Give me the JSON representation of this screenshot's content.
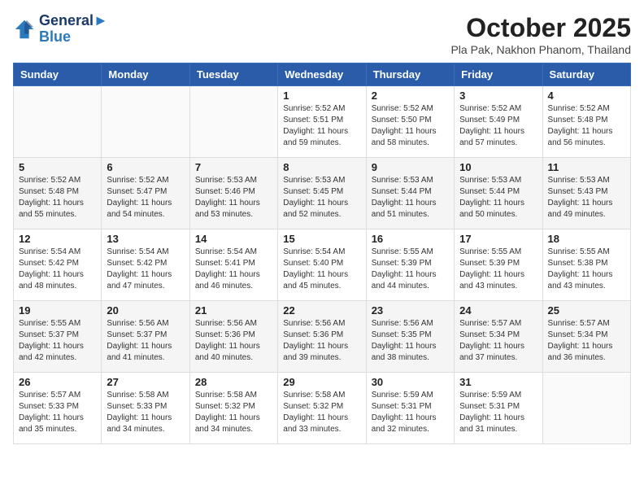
{
  "header": {
    "logo_line1": "General",
    "logo_line2": "Blue",
    "month": "October 2025",
    "location": "Pla Pak, Nakhon Phanom, Thailand"
  },
  "weekdays": [
    "Sunday",
    "Monday",
    "Tuesday",
    "Wednesday",
    "Thursday",
    "Friday",
    "Saturday"
  ],
  "weeks": [
    [
      {
        "day": "",
        "info": ""
      },
      {
        "day": "",
        "info": ""
      },
      {
        "day": "",
        "info": ""
      },
      {
        "day": "1",
        "info": "Sunrise: 5:52 AM\nSunset: 5:51 PM\nDaylight: 11 hours\nand 59 minutes."
      },
      {
        "day": "2",
        "info": "Sunrise: 5:52 AM\nSunset: 5:50 PM\nDaylight: 11 hours\nand 58 minutes."
      },
      {
        "day": "3",
        "info": "Sunrise: 5:52 AM\nSunset: 5:49 PM\nDaylight: 11 hours\nand 57 minutes."
      },
      {
        "day": "4",
        "info": "Sunrise: 5:52 AM\nSunset: 5:48 PM\nDaylight: 11 hours\nand 56 minutes."
      }
    ],
    [
      {
        "day": "5",
        "info": "Sunrise: 5:52 AM\nSunset: 5:48 PM\nDaylight: 11 hours\nand 55 minutes."
      },
      {
        "day": "6",
        "info": "Sunrise: 5:52 AM\nSunset: 5:47 PM\nDaylight: 11 hours\nand 54 minutes."
      },
      {
        "day": "7",
        "info": "Sunrise: 5:53 AM\nSunset: 5:46 PM\nDaylight: 11 hours\nand 53 minutes."
      },
      {
        "day": "8",
        "info": "Sunrise: 5:53 AM\nSunset: 5:45 PM\nDaylight: 11 hours\nand 52 minutes."
      },
      {
        "day": "9",
        "info": "Sunrise: 5:53 AM\nSunset: 5:44 PM\nDaylight: 11 hours\nand 51 minutes."
      },
      {
        "day": "10",
        "info": "Sunrise: 5:53 AM\nSunset: 5:44 PM\nDaylight: 11 hours\nand 50 minutes."
      },
      {
        "day": "11",
        "info": "Sunrise: 5:53 AM\nSunset: 5:43 PM\nDaylight: 11 hours\nand 49 minutes."
      }
    ],
    [
      {
        "day": "12",
        "info": "Sunrise: 5:54 AM\nSunset: 5:42 PM\nDaylight: 11 hours\nand 48 minutes."
      },
      {
        "day": "13",
        "info": "Sunrise: 5:54 AM\nSunset: 5:42 PM\nDaylight: 11 hours\nand 47 minutes."
      },
      {
        "day": "14",
        "info": "Sunrise: 5:54 AM\nSunset: 5:41 PM\nDaylight: 11 hours\nand 46 minutes."
      },
      {
        "day": "15",
        "info": "Sunrise: 5:54 AM\nSunset: 5:40 PM\nDaylight: 11 hours\nand 45 minutes."
      },
      {
        "day": "16",
        "info": "Sunrise: 5:55 AM\nSunset: 5:39 PM\nDaylight: 11 hours\nand 44 minutes."
      },
      {
        "day": "17",
        "info": "Sunrise: 5:55 AM\nSunset: 5:39 PM\nDaylight: 11 hours\nand 43 minutes."
      },
      {
        "day": "18",
        "info": "Sunrise: 5:55 AM\nSunset: 5:38 PM\nDaylight: 11 hours\nand 43 minutes."
      }
    ],
    [
      {
        "day": "19",
        "info": "Sunrise: 5:55 AM\nSunset: 5:37 PM\nDaylight: 11 hours\nand 42 minutes."
      },
      {
        "day": "20",
        "info": "Sunrise: 5:56 AM\nSunset: 5:37 PM\nDaylight: 11 hours\nand 41 minutes."
      },
      {
        "day": "21",
        "info": "Sunrise: 5:56 AM\nSunset: 5:36 PM\nDaylight: 11 hours\nand 40 minutes."
      },
      {
        "day": "22",
        "info": "Sunrise: 5:56 AM\nSunset: 5:36 PM\nDaylight: 11 hours\nand 39 minutes."
      },
      {
        "day": "23",
        "info": "Sunrise: 5:56 AM\nSunset: 5:35 PM\nDaylight: 11 hours\nand 38 minutes."
      },
      {
        "day": "24",
        "info": "Sunrise: 5:57 AM\nSunset: 5:34 PM\nDaylight: 11 hours\nand 37 minutes."
      },
      {
        "day": "25",
        "info": "Sunrise: 5:57 AM\nSunset: 5:34 PM\nDaylight: 11 hours\nand 36 minutes."
      }
    ],
    [
      {
        "day": "26",
        "info": "Sunrise: 5:57 AM\nSunset: 5:33 PM\nDaylight: 11 hours\nand 35 minutes."
      },
      {
        "day": "27",
        "info": "Sunrise: 5:58 AM\nSunset: 5:33 PM\nDaylight: 11 hours\nand 34 minutes."
      },
      {
        "day": "28",
        "info": "Sunrise: 5:58 AM\nSunset: 5:32 PM\nDaylight: 11 hours\nand 34 minutes."
      },
      {
        "day": "29",
        "info": "Sunrise: 5:58 AM\nSunset: 5:32 PM\nDaylight: 11 hours\nand 33 minutes."
      },
      {
        "day": "30",
        "info": "Sunrise: 5:59 AM\nSunset: 5:31 PM\nDaylight: 11 hours\nand 32 minutes."
      },
      {
        "day": "31",
        "info": "Sunrise: 5:59 AM\nSunset: 5:31 PM\nDaylight: 11 hours\nand 31 minutes."
      },
      {
        "day": "",
        "info": ""
      }
    ]
  ]
}
